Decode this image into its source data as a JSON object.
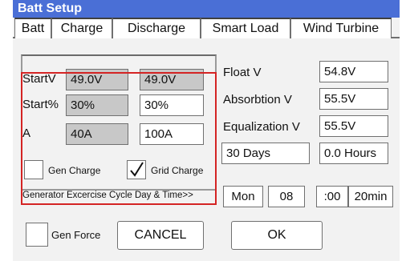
{
  "window": {
    "title": "Batt Setup"
  },
  "tabs": [
    {
      "label": "Batt"
    },
    {
      "label": "Charge"
    },
    {
      "label": "Discharge"
    },
    {
      "label": "Smart Load"
    },
    {
      "label": "Wind Turbine"
    }
  ],
  "charge_table": {
    "rows": [
      {
        "label": "StartV",
        "gen_value": "49.0V",
        "grid_value": "49.0V"
      },
      {
        "label": "Start%",
        "gen_value": "30%",
        "grid_value": "30%"
      },
      {
        "label": "A",
        "gen_value": "40A",
        "grid_value": "100A"
      }
    ],
    "gen_charge_label": "Gen Charge",
    "gen_charge_checked": false,
    "grid_charge_label": "Grid Charge",
    "grid_charge_checked": true
  },
  "voltages": {
    "float_label": "Float V",
    "float_value": "54.8V",
    "absorption_label": "Absorbtion V",
    "absorption_value": "55.5V",
    "equalization_label": "Equalization V",
    "equalization_value": "55.5V",
    "days_value": "30 Days",
    "hours_value": "0.0 Hours"
  },
  "exercise": {
    "label": "Generator Excercise Cycle Day & Time>>",
    "day": "Mon",
    "hour": "08",
    "minute": ":00",
    "duration": "20min"
  },
  "footer": {
    "gen_force_label": "Gen Force",
    "gen_force_checked": false,
    "cancel_label": "CANCEL",
    "ok_label": "OK"
  },
  "colors": {
    "titlebar": "#4a6fd6",
    "highlight": "#d42424",
    "readonly_field": "#c8c8c8"
  }
}
